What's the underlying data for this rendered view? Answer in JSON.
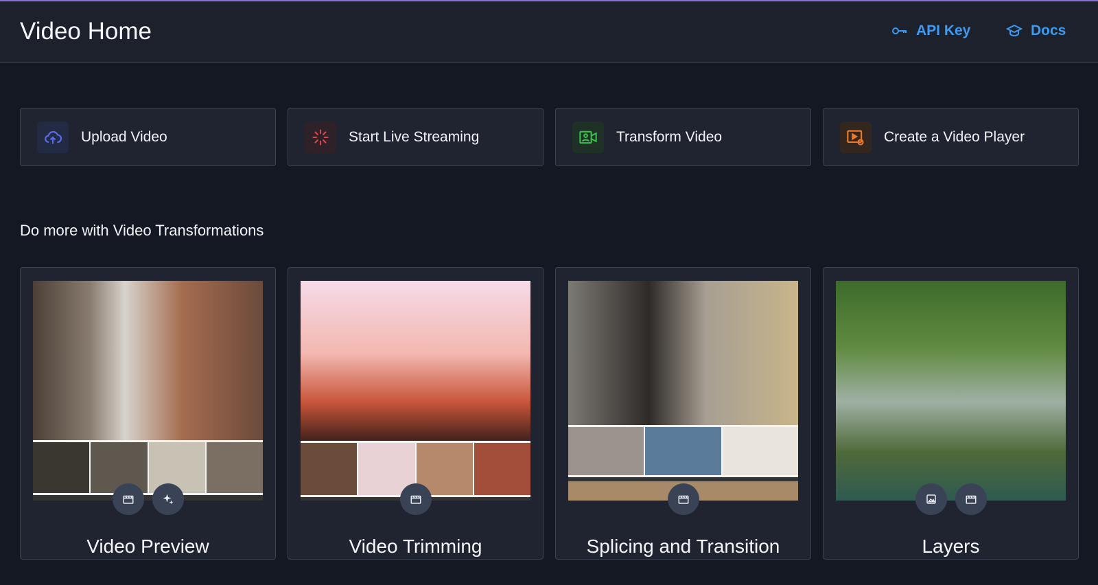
{
  "header": {
    "title": "Video Home",
    "api_key_label": "API Key",
    "docs_label": "Docs",
    "api_key_icon": "key-icon",
    "docs_icon": "graduation-cap-icon",
    "link_color": "#3d9bf5"
  },
  "actions": [
    {
      "label": "Upload Video",
      "icon": "cloud-upload-icon",
      "color": "#5b6cf0"
    },
    {
      "label": "Start Live Streaming",
      "icon": "live-stream-icon",
      "color": "#e0454a"
    },
    {
      "label": "Transform Video",
      "icon": "video-camera-icon",
      "color": "#3bbf4b"
    },
    {
      "label": "Create a Video Player",
      "icon": "video-player-gear-icon",
      "color": "#f07a2a"
    }
  ],
  "section": {
    "title": "Do more with Video Transformations"
  },
  "cards": [
    {
      "title": "Video Preview",
      "badges": [
        "clapperboard-icon",
        "sparkle-icon"
      ]
    },
    {
      "title": "Video Trimming",
      "badges": [
        "clapperboard-icon"
      ]
    },
    {
      "title": "Splicing and Transition",
      "badges": [
        "clapperboard-icon"
      ]
    },
    {
      "title": "Layers",
      "badges": [
        "image-icon",
        "clapperboard-icon"
      ]
    }
  ]
}
